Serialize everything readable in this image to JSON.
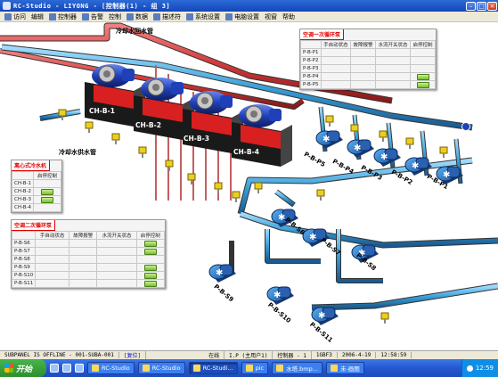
{
  "window": {
    "title": "RC-Studio - LIYONG - [控制器(1) - 组 3]"
  },
  "menu": [
    {
      "label": "访问",
      "icon": "door-icon"
    },
    {
      "label": "编辑"
    },
    {
      "label": "控制器",
      "icon": "controller-icon"
    },
    {
      "label": "告警",
      "icon": "alarm-icon"
    },
    {
      "label": "控制"
    },
    {
      "label": "数据",
      "icon": "data-icon"
    },
    {
      "label": "描述符",
      "icon": "descriptor-icon"
    },
    {
      "label": "系统设置",
      "icon": "settings-icon"
    },
    {
      "label": "电脑设置",
      "icon": "pc-icon"
    },
    {
      "label": "视窗"
    },
    {
      "label": "帮助"
    }
  ],
  "labels": {
    "cooling_tower_return": "冷却水回水管",
    "cooling_supply": "冷却水供水管"
  },
  "chillers": [
    "CH-B-1",
    "CH-B-2",
    "CH-B-3",
    "CH-B-4"
  ],
  "pumps_primary": [
    "P-B-P5",
    "P-B-P4",
    "P-B-P3",
    "P-B-P2",
    "P-B-P1"
  ],
  "pumps_secondary": [
    "P-B-S6",
    "P-B-S7",
    "P-B-S8",
    "P-B-S9",
    "P-B-S10",
    "P-B-S11"
  ],
  "panel_chiller": {
    "title": "离心式冷水机",
    "col": "启停控制",
    "rows": [
      "CH-B-1",
      "CH-B-2",
      "CH-B-3",
      "CH-B-4"
    ],
    "buttons": [
      false,
      true,
      true,
      false
    ]
  },
  "panel_primary": {
    "title": "空调一次循环泵",
    "cols": [
      "手自动状态",
      "故障报警",
      "水流开关状态",
      "启停控制"
    ],
    "rows": [
      "P-B-P1",
      "P-B-P2",
      "P-B-P3",
      "P-B-P4",
      "P-B-P5"
    ],
    "buttons": [
      false,
      false,
      false,
      true,
      true
    ]
  },
  "panel_secondary": {
    "title": "空调二次循环泵",
    "cols": [
      "手自动状态",
      "故障报警",
      "水流开关状态",
      "启停控制"
    ],
    "rows": [
      "P-B-S6",
      "P-B-S7",
      "P-B-S8",
      "P-B-S9",
      "P-B-S10",
      "P-B-S11"
    ],
    "buttons": [
      true,
      true,
      false,
      true,
      true,
      true
    ]
  },
  "status": {
    "offline": "SUBPANEL IS OFFLINE - 001-SUBA-001",
    "reset": "[复位]",
    "online": "在线",
    "ip": "I.P (主用户1)",
    "controller": "控制器 - 1",
    "dev": "1GBF3",
    "date": "2006-4-19",
    "time": "12:58:59"
  },
  "taskbar": {
    "start": "开始",
    "tasks": [
      "RC-Studio",
      "RC-Studio",
      "RC-Studi...",
      "pic",
      "水塔.bmp...",
      "未-画图"
    ],
    "clock": "12:59"
  },
  "colors": {
    "return_pipe": "#d43a3a",
    "supply_pipe": "#3aa0d8",
    "chiller_body": "#d82020",
    "chiller_motor": "#2040b8"
  }
}
